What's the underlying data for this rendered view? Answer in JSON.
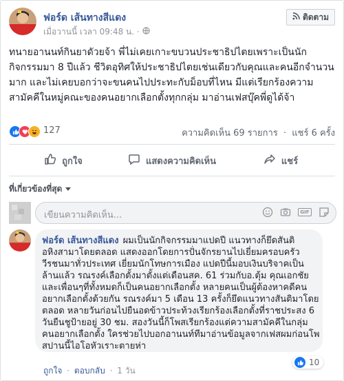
{
  "post": {
    "author": "ฟอร์ด เส้นทางสีแดง",
    "meta_time": "เมื่อวานนี้ เวลา 09:48 น.",
    "meta_sep": "·",
    "follow_label": "ติดตาม",
    "body": "ทนายอานนท์กินยาดัวยจ้า พี่ไม่เคยเกาะขบวนประชาธิปไตยเพราะเป็นนักกิจกรรมมา 8 ปีแล้ว ชีวิตอุทิศให้ประชาธิปไตยเช่นเดียวกับคุณและคนอีกจำนวนมาก และไม่เคยบอกว่าจะขนคนไปประทะกับม็อบที่ไหน มีแต่เรียกร้องความสามัคคีในหมู่คณะของคนอยากเลือกตั้งทุกกลุ่ม มาอ่านเฟสบุ๊คพี่ดูได้จ้า"
  },
  "stats": {
    "reaction_count": "127",
    "comments": "ความคิดเห็น 69 รายการ",
    "shares": "แชร์ 6 ครั้ง"
  },
  "actions": {
    "like": "ถูกใจ",
    "comment": "แสดงความคิดเห็น",
    "share": "แชร์"
  },
  "comments_section": {
    "sort_label": "ที่เกี่ยวข้องที่สุด",
    "input_placeholder": "เขียนความคิดเห็น...",
    "gif_label": "GIF"
  },
  "comment": {
    "author": "ฟอร์ด เส้นทางสีแดง",
    "text": "ผมเป็นนักกิจกรรมมาแปดปี แนวทางก็ยึดสันติ อหิงสามาโดยตลอด แสดงออกโดยการปั่นจักรยานไปเยี่ยมครอบครัววีรชนมาทั่วประเทศ เยี่ยมนักโทษการเมือง แปดปีนี้มอบเงินบริจาคเป็นล้านแล้ว รณรงค์เลือกตั้งมาตั้งแต่เดือนสค. 61 ร่วมกับอ.ตุ้ม คุณเอกชัย และเพื่อนๆที่ทั้งหมดก็เป็นคนอยากเลือกตั้ง หลายคนเป็นผู้ต้องหาคดีคนอยากเลือกตั้งด้วยกัน รณรงค์มา 5 เดือน 13 ครั้งก็ยึดแนวทางสันติมาโดยตลอด หลายวันก่อนไปยืนอดข้าวประท้วงเรียกร้องเลือกตั้งที่ราชประสง 6 วันยืนชูป้ายอยู่ 30 ชม. สองวันนี้ก็โพสเรียกร้องแต่ความสามัคคีในกลุ่มคนอยากเลือกตั้ง ใครช่วยไปบอกอานนท์ทีมาอ่านข้อมูลจากเฟสผมก่อนโพสปานนี้ไอโอหัวเราะตายห่า",
    "reaction_count": "10",
    "like_label": "ถูกใจ",
    "reply_label": "ตอบกลับ",
    "time": "1 วัน",
    "sep": "·"
  },
  "colors": {
    "link_blue": "#365899",
    "like_blue": "#1877f2",
    "love_red": "#f33e58",
    "haha_yellow": "#f7b125"
  },
  "icons": [
    "globe-icon",
    "rss-icon",
    "like-icon",
    "love-icon",
    "haha-icon",
    "comment-icon",
    "share-icon",
    "caret-down-icon",
    "emoji-icon",
    "camera-icon",
    "sticker-icon"
  ]
}
